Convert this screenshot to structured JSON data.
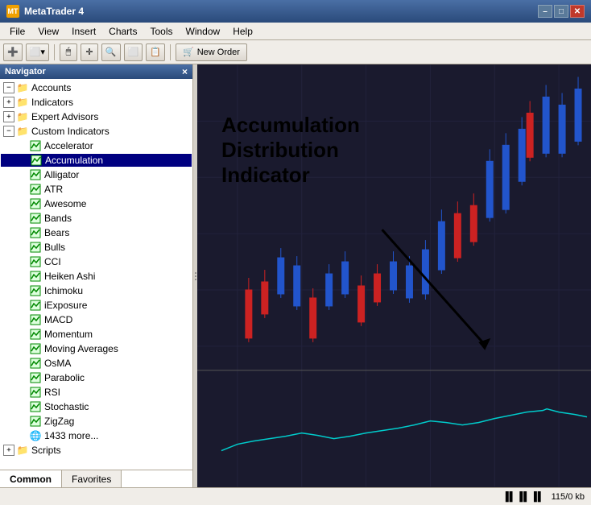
{
  "titleBar": {
    "title": "MetaTrader 4",
    "minimizeLabel": "–",
    "maximizeLabel": "□",
    "closeLabel": "✕"
  },
  "menuBar": {
    "items": [
      "File",
      "View",
      "Insert",
      "Charts",
      "Tools",
      "Window",
      "Help"
    ]
  },
  "toolbar": {
    "newOrderLabel": "New Order"
  },
  "navigator": {
    "title": "Navigator",
    "closeLabel": "×",
    "tree": [
      {
        "id": "accounts",
        "level": 0,
        "label": "Accounts",
        "expanded": true,
        "icon": "folder",
        "hasExpand": true
      },
      {
        "id": "indicators",
        "level": 0,
        "label": "Indicators",
        "expanded": false,
        "icon": "folder",
        "hasExpand": true
      },
      {
        "id": "expert-advisors",
        "level": 0,
        "label": "Expert Advisors",
        "expanded": false,
        "icon": "folder",
        "hasExpand": true
      },
      {
        "id": "custom-indicators",
        "level": 0,
        "label": "Custom Indicators",
        "expanded": true,
        "icon": "folder",
        "hasExpand": true
      },
      {
        "id": "accelerator",
        "level": 1,
        "label": "Accelerator",
        "icon": "indicator",
        "hasExpand": false
      },
      {
        "id": "accumulation",
        "level": 1,
        "label": "Accumulation",
        "icon": "indicator",
        "hasExpand": false,
        "highlighted": true
      },
      {
        "id": "alligator",
        "level": 1,
        "label": "Alligator",
        "icon": "indicator",
        "hasExpand": false
      },
      {
        "id": "atr",
        "level": 1,
        "label": "ATR",
        "icon": "indicator",
        "hasExpand": false
      },
      {
        "id": "awesome",
        "level": 1,
        "label": "Awesome",
        "icon": "indicator",
        "hasExpand": false
      },
      {
        "id": "bands",
        "level": 1,
        "label": "Bands",
        "icon": "indicator",
        "hasExpand": false
      },
      {
        "id": "bears",
        "level": 1,
        "label": "Bears",
        "icon": "indicator",
        "hasExpand": false
      },
      {
        "id": "bulls",
        "level": 1,
        "label": "Bulls",
        "icon": "indicator",
        "hasExpand": false
      },
      {
        "id": "cci",
        "level": 1,
        "label": "CCI",
        "icon": "indicator",
        "hasExpand": false
      },
      {
        "id": "heiken-ashi",
        "level": 1,
        "label": "Heiken Ashi",
        "icon": "indicator",
        "hasExpand": false
      },
      {
        "id": "ichimoku",
        "level": 1,
        "label": "Ichimoku",
        "icon": "indicator",
        "hasExpand": false
      },
      {
        "id": "iexposure",
        "level": 1,
        "label": "iExposure",
        "icon": "indicator",
        "hasExpand": false
      },
      {
        "id": "macd",
        "level": 1,
        "label": "MACD",
        "icon": "indicator",
        "hasExpand": false
      },
      {
        "id": "momentum",
        "level": 1,
        "label": "Momentum",
        "icon": "indicator",
        "hasExpand": false
      },
      {
        "id": "moving-averages",
        "level": 1,
        "label": "Moving Averages",
        "icon": "indicator",
        "hasExpand": false
      },
      {
        "id": "osma",
        "level": 1,
        "label": "OsMA",
        "icon": "indicator",
        "hasExpand": false
      },
      {
        "id": "parabolic",
        "level": 1,
        "label": "Parabolic",
        "icon": "indicator",
        "hasExpand": false
      },
      {
        "id": "rsi",
        "level": 1,
        "label": "RSI",
        "icon": "indicator",
        "hasExpand": false
      },
      {
        "id": "stochastic",
        "level": 1,
        "label": "Stochastic",
        "icon": "indicator",
        "hasExpand": false
      },
      {
        "id": "zigzag",
        "level": 1,
        "label": "ZigZag",
        "icon": "indicator",
        "hasExpand": false
      },
      {
        "id": "more",
        "level": 1,
        "label": "1433 more...",
        "icon": "globe",
        "hasExpand": false
      },
      {
        "id": "scripts",
        "level": 0,
        "label": "Scripts",
        "expanded": false,
        "icon": "folder",
        "hasExpand": true
      }
    ],
    "tabs": [
      {
        "id": "common",
        "label": "Common",
        "active": true
      },
      {
        "id": "favorites",
        "label": "Favorites",
        "active": false
      }
    ]
  },
  "annotation": {
    "line1": "Accumulation",
    "line2": "Distribution",
    "line3": "Indicator"
  },
  "statusBar": {
    "memory": "115/0 kb"
  }
}
